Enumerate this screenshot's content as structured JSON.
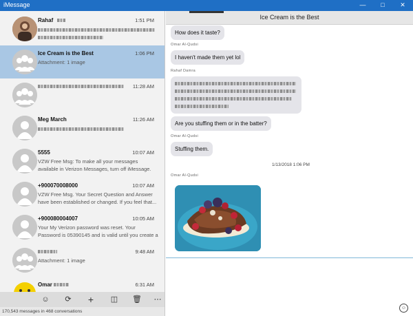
{
  "window": {
    "title": "iMessage",
    "minimize_icon": "minimize-icon",
    "maximize_icon": "maximize-icon",
    "close_icon": "close-icon"
  },
  "conversations": [
    {
      "name": "Rahaf",
      "time": "1:51 PM",
      "preview": "",
      "avatar": "photo",
      "selected": false
    },
    {
      "name": "Ice Cream is the Best",
      "time": "1:06 PM",
      "preview": "Attachment: 1 image",
      "avatar": "group",
      "selected": true
    },
    {
      "name": "",
      "time": "11:28 AM",
      "preview": "",
      "avatar": "group",
      "selected": false
    },
    {
      "name": "Meg March",
      "time": "11:26 AM",
      "preview": "",
      "avatar": "person",
      "selected": false
    },
    {
      "name": "5555",
      "time": "10:07 AM",
      "preview": "VZW Free Msg: To make all your messages available in Verizon Messages, turn off iMessage. Otherwise,...",
      "avatar": "person",
      "selected": false
    },
    {
      "name": "+900070008000",
      "time": "10:07 AM",
      "preview": "VZW Free Msg. Your Secret Question and Answer have been established or changed. If you feel that...",
      "avatar": "person",
      "selected": false
    },
    {
      "name": "+900080004007",
      "time": "10:05 AM",
      "preview": "Your My Verizon password was reset. Your Password is 05390145 and is valid until you create a new one....",
      "avatar": "person",
      "selected": false
    },
    {
      "name": "",
      "time": "9:48 AM",
      "preview": "Attachment: 1 image",
      "avatar": "group",
      "selected": false
    },
    {
      "name": "Omar",
      "time": "6:31 AM",
      "preview": "",
      "avatar": "emoji",
      "selected": false
    }
  ],
  "toolbar": {
    "buttons": [
      "smiley-icon",
      "refresh-icon",
      "add-icon",
      "attachment-icon",
      "delete-icon",
      "more-icon"
    ]
  },
  "status": "170,543 messages in 468 conversations",
  "chat": {
    "title": "Ice Cream is the Best",
    "messages": [
      {
        "type": "bubble",
        "text": "How does it taste?"
      },
      {
        "type": "sender",
        "text": "Omar Al-Qudsi"
      },
      {
        "type": "bubble",
        "text": "I haven't made them yet lol"
      },
      {
        "type": "sender",
        "text": "Rahaf Damra"
      },
      {
        "type": "bubble-redacted",
        "text": ""
      },
      {
        "type": "bubble",
        "text": "Are you stuffing them or in the batter?"
      },
      {
        "type": "sender",
        "text": "Omar Al-Qudsi"
      },
      {
        "type": "bubble",
        "text": "Stuffing them."
      },
      {
        "type": "timestamp",
        "text": "1/13/2018 1:06 PM"
      },
      {
        "type": "sender",
        "text": "Omar Al-Qudsi"
      }
    ],
    "attachment": "photo",
    "emoji_button_icon": "emoji-icon"
  }
}
